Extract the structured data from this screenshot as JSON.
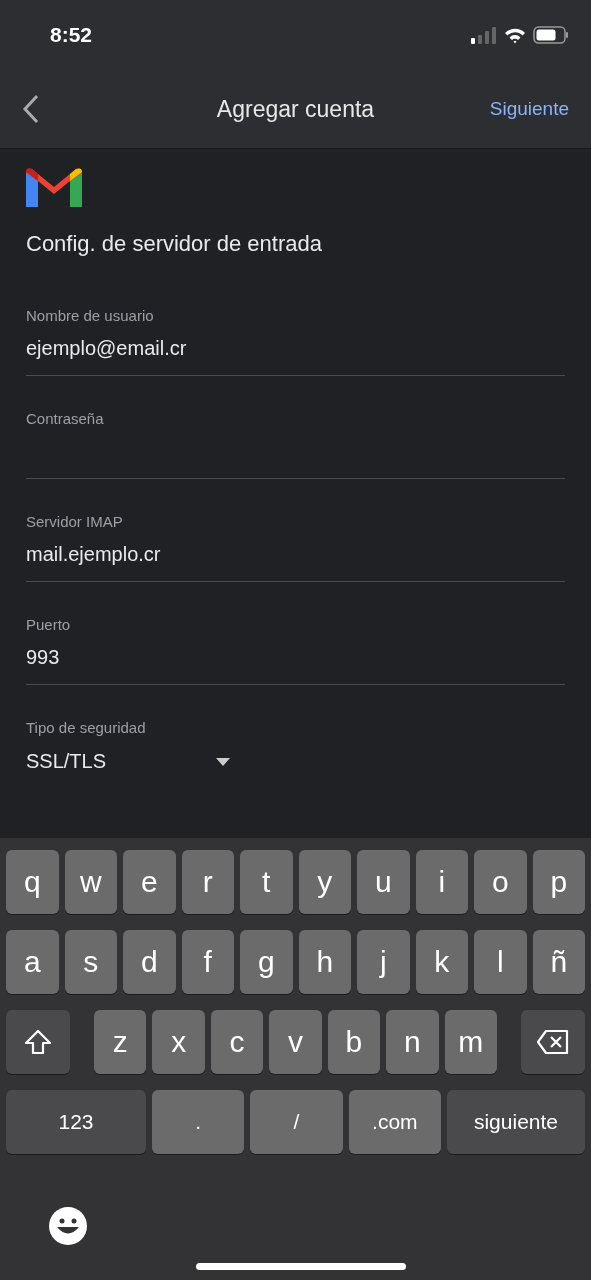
{
  "status_bar": {
    "time": "8:52"
  },
  "nav": {
    "title": "Agregar cuenta",
    "action": "Siguiente"
  },
  "heading": "Config. de servidor de entrada",
  "fields": [
    {
      "kind": "text",
      "label": "Nombre de usuario",
      "value": "ejemplo@email.cr"
    },
    {
      "kind": "password",
      "label": "Contraseña"
    },
    {
      "kind": "text",
      "label": "Servidor IMAP",
      "value": "mail.ejemplo.cr"
    },
    {
      "kind": "text",
      "label": "Puerto",
      "value": "993"
    },
    {
      "kind": "select",
      "label": "Tipo de seguridad",
      "value": "SSL/TLS"
    }
  ],
  "keyboard": {
    "letter_rows": [
      [
        {
          "kind": "letter",
          "label": "q"
        },
        {
          "kind": "letter",
          "label": "w"
        },
        {
          "kind": "letter",
          "label": "e"
        },
        {
          "kind": "letter",
          "label": "r"
        },
        {
          "kind": "letter",
          "label": "t"
        },
        {
          "kind": "letter",
          "label": "y"
        },
        {
          "kind": "letter",
          "label": "u"
        },
        {
          "kind": "letter",
          "label": "i"
        },
        {
          "kind": "letter",
          "label": "o"
        },
        {
          "kind": "letter",
          "label": "p"
        }
      ],
      [
        {
          "kind": "letter",
          "label": "a"
        },
        {
          "kind": "letter",
          "label": "s"
        },
        {
          "kind": "letter",
          "label": "d"
        },
        {
          "kind": "letter",
          "label": "f"
        },
        {
          "kind": "letter",
          "label": "g"
        },
        {
          "kind": "letter",
          "label": "h"
        },
        {
          "kind": "letter",
          "label": "j"
        },
        {
          "kind": "letter",
          "label": "k"
        },
        {
          "kind": "letter",
          "label": "l"
        },
        {
          "kind": "letter",
          "label": "ñ"
        }
      ],
      [
        {
          "kind": "shift"
        },
        {
          "kind": "letter",
          "label": "z"
        },
        {
          "kind": "letter",
          "label": "x"
        },
        {
          "kind": "letter",
          "label": "c"
        },
        {
          "kind": "letter",
          "label": "v"
        },
        {
          "kind": "letter",
          "label": "b"
        },
        {
          "kind": "letter",
          "label": "n"
        },
        {
          "kind": "letter",
          "label": "m"
        },
        {
          "kind": "backspace"
        }
      ]
    ],
    "bottom_row": [
      {
        "kind": "numbers",
        "label": "123"
      },
      {
        "kind": "symbol",
        "label": "."
      },
      {
        "kind": "symbol",
        "label": "/"
      },
      {
        "kind": "symbol",
        "label": ".com"
      },
      {
        "kind": "return",
        "label": "siguiente"
      }
    ]
  }
}
